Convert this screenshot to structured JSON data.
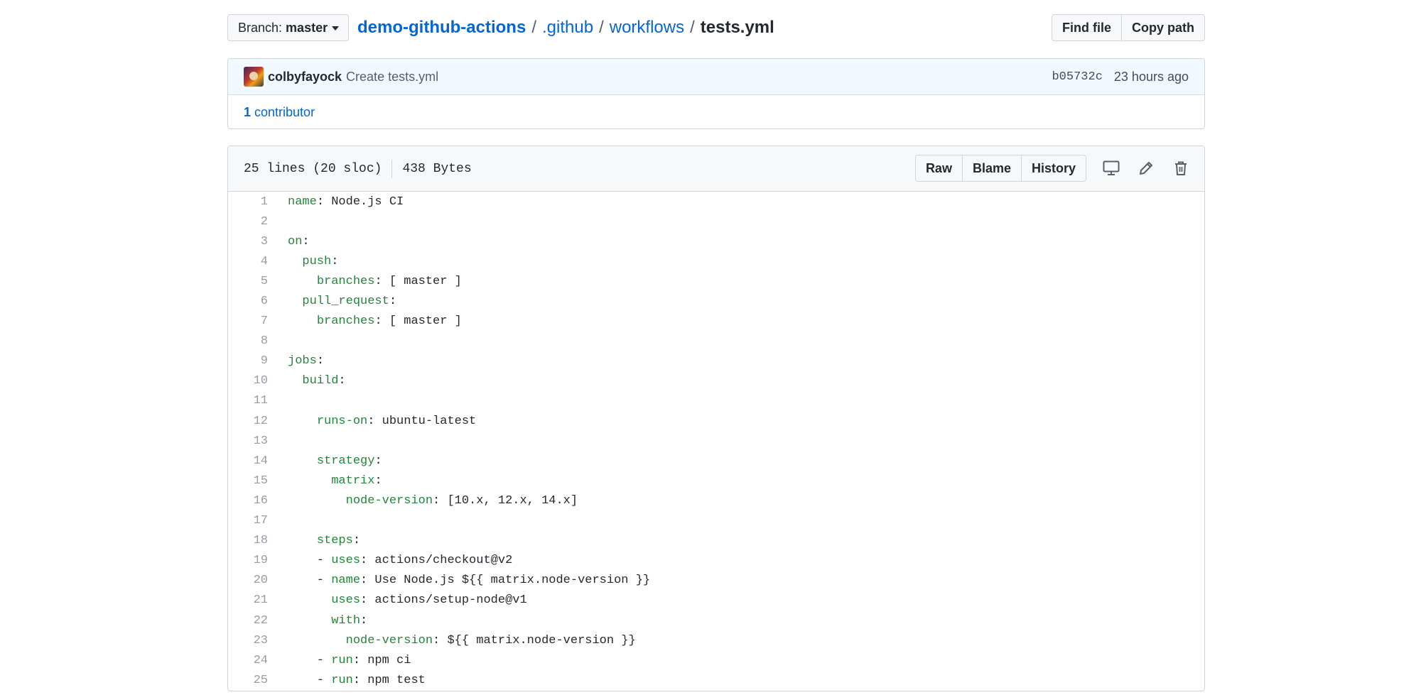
{
  "topbar": {
    "branch_label": "Branch:",
    "branch_value": "master",
    "breadcrumb": {
      "repo": "demo-github-actions",
      "dir1": ".github",
      "dir2": "workflows",
      "file": "tests.yml",
      "separator": "/"
    },
    "find_file": "Find file",
    "copy_path": "Copy path"
  },
  "commit": {
    "author": "colbyfayock",
    "message": "Create tests.yml",
    "sha": "b05732c",
    "time": "23 hours ago",
    "contributors_count": "1",
    "contributors_label": "contributor"
  },
  "file": {
    "lines_info": "25 lines (20 sloc)",
    "size": "438 Bytes",
    "raw": "Raw",
    "blame": "Blame",
    "history": "History",
    "icons": [
      "desktop-icon",
      "pencil-icon",
      "trash-icon"
    ]
  },
  "code_lines": [
    {
      "n": "1",
      "indent": "",
      "key": "name",
      "rest": ": Node.js CI"
    },
    {
      "n": "2",
      "indent": "",
      "key": "",
      "rest": ""
    },
    {
      "n": "3",
      "indent": "",
      "key": "on",
      "rest": ":"
    },
    {
      "n": "4",
      "indent": "  ",
      "key": "push",
      "rest": ":"
    },
    {
      "n": "5",
      "indent": "    ",
      "key": "branches",
      "rest": ": [ master ]"
    },
    {
      "n": "6",
      "indent": "  ",
      "key": "pull_request",
      "rest": ":"
    },
    {
      "n": "7",
      "indent": "    ",
      "key": "branches",
      "rest": ": [ master ]"
    },
    {
      "n": "8",
      "indent": "",
      "key": "",
      "rest": ""
    },
    {
      "n": "9",
      "indent": "",
      "key": "jobs",
      "rest": ":"
    },
    {
      "n": "10",
      "indent": "  ",
      "key": "build",
      "rest": ":"
    },
    {
      "n": "11",
      "indent": "",
      "key": "",
      "rest": ""
    },
    {
      "n": "12",
      "indent": "    ",
      "key": "runs-on",
      "rest": ": ubuntu-latest"
    },
    {
      "n": "13",
      "indent": "",
      "key": "",
      "rest": ""
    },
    {
      "n": "14",
      "indent": "    ",
      "key": "strategy",
      "rest": ":"
    },
    {
      "n": "15",
      "indent": "      ",
      "key": "matrix",
      "rest": ":"
    },
    {
      "n": "16",
      "indent": "        ",
      "key": "node-version",
      "rest": ": [10.x, 12.x, 14.x]"
    },
    {
      "n": "17",
      "indent": "",
      "key": "",
      "rest": ""
    },
    {
      "n": "18",
      "indent": "    ",
      "key": "steps",
      "rest": ":"
    },
    {
      "n": "19",
      "indent": "    - ",
      "key": "uses",
      "rest": ": actions/checkout@v2"
    },
    {
      "n": "20",
      "indent": "    - ",
      "key": "name",
      "rest": ": Use Node.js ${{ matrix.node-version }}"
    },
    {
      "n": "21",
      "indent": "      ",
      "key": "uses",
      "rest": ": actions/setup-node@v1"
    },
    {
      "n": "22",
      "indent": "      ",
      "key": "with",
      "rest": ":"
    },
    {
      "n": "23",
      "indent": "        ",
      "key": "node-version",
      "rest": ": ${{ matrix.node-version }}"
    },
    {
      "n": "24",
      "indent": "    - ",
      "key": "run",
      "rest": ": npm ci"
    },
    {
      "n": "25",
      "indent": "    - ",
      "key": "run",
      "rest": ": npm test"
    }
  ],
  "colors": {
    "link": "#0366d6",
    "yaml_key": "#22863a",
    "line_number": "#959da5",
    "commit_bg": "#f1f8ff"
  }
}
